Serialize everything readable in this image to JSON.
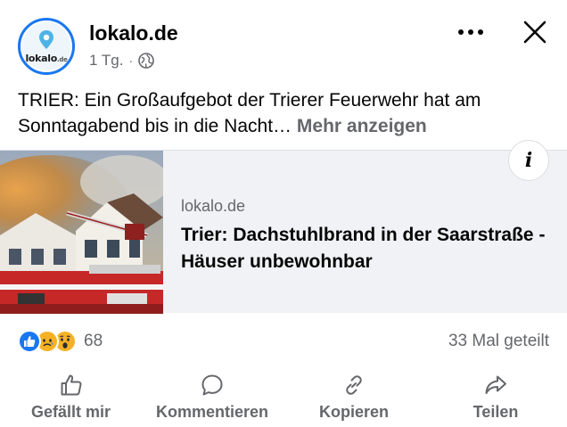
{
  "post": {
    "page_name": "lokalo.de",
    "avatar_text": "lokalo",
    "avatar_text_suffix": ".de",
    "time": "1 Tg.",
    "meta_separator": "·",
    "privacy_icon": "globe-icon",
    "text": "TRIER: Ein Großaufgebot der Trierer Feuerwehr hat am Sonntagabend bis in die Nacht…",
    "see_more": "Mehr anzeigen"
  },
  "header": {
    "more_icon": "more-horizontal-icon",
    "close_icon": "close-icon"
  },
  "link": {
    "domain": "lokalo.de",
    "title": "Trier: Dachstuhlbrand in der Saarstraße - Häuser unbewohnbar",
    "info_label": "i"
  },
  "stats": {
    "reaction_count": "68",
    "shares": "33 Mal geteilt",
    "reactions": [
      "like-icon",
      "sad-icon",
      "wow-icon"
    ]
  },
  "actions": [
    {
      "label": "Gefällt mir",
      "icon": "thumbs-up-icon"
    },
    {
      "label": "Kommentieren",
      "icon": "comment-icon"
    },
    {
      "label": "Kopieren",
      "icon": "link-icon"
    },
    {
      "label": "Teilen",
      "icon": "share-icon"
    }
  ],
  "colors": {
    "accent": "#1877f2",
    "secondary_text": "#65676b",
    "card_background": "#f0f2f5"
  }
}
